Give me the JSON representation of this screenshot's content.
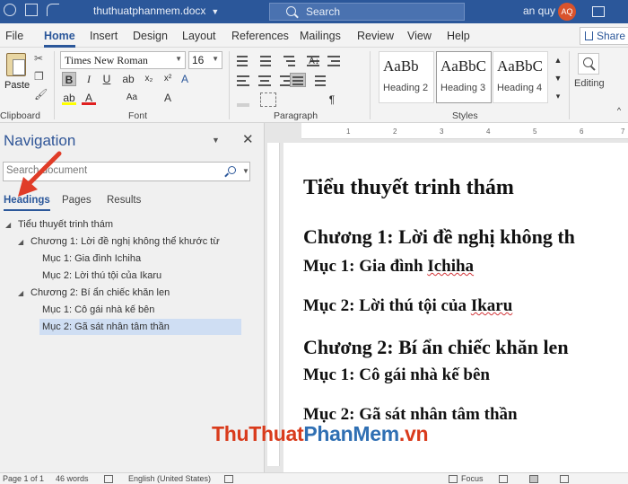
{
  "titlebar": {
    "doc_title": "thuthuatphanmem.docx",
    "search_placeholder": "Search",
    "user_name": "an quy",
    "user_initials": "AQ"
  },
  "tabs": [
    "File",
    "Home",
    "Insert",
    "Design",
    "Layout",
    "References",
    "Mailings",
    "Review",
    "View",
    "Help"
  ],
  "active_tab": "Home",
  "share_label": "Share",
  "ribbon": {
    "clipboard": {
      "paste_label": "Paste",
      "group_label": "Clipboard"
    },
    "font": {
      "font_name": "Times New Roman",
      "font_size": "16",
      "group_label": "Font"
    },
    "paragraph": {
      "group_label": "Paragraph"
    },
    "styles": {
      "group_label": "Styles",
      "items": [
        {
          "sample": "AaBb",
          "name": "Heading 2"
        },
        {
          "sample": "AaBbC",
          "name": "Heading 3"
        },
        {
          "sample": "AaBbC",
          "name": "Heading 4"
        }
      ]
    },
    "editing": {
      "label": "Editing"
    }
  },
  "nav": {
    "title": "Navigation",
    "search_placeholder": "Search document",
    "tabs": [
      "Headings",
      "Pages",
      "Results"
    ],
    "active_tab": "Headings",
    "tree": [
      {
        "label": "Tiểu thuyết trinh thám",
        "level": 1,
        "expanded": true
      },
      {
        "label": "Chương 1: Lời đề nghị không thể khước từ",
        "level": 2,
        "expanded": true
      },
      {
        "label": "Mục 1: Gia đình Ichiha",
        "level": 3
      },
      {
        "label": "Mục 2: Lời thú tội của Ikaru",
        "level": 3
      },
      {
        "label": "Chương 2: Bí ẩn chiếc khăn len",
        "level": 2,
        "expanded": true
      },
      {
        "label": "Mục 1: Cô gái nhà kế bên",
        "level": 3
      },
      {
        "label": "Mục 2: Gã sát nhân tâm thần",
        "level": 3,
        "selected": true
      }
    ]
  },
  "document": {
    "title": "Tiểu thuyết trinh thám",
    "ch1": "Chương 1: Lời đề nghị không th",
    "ch1_m1_prefix": "Mục 1: Gia đình ",
    "ch1_m1_word": "Ichiha",
    "ch1_m2_prefix": "Mục 2: Lời thú tội của ",
    "ch1_m2_word": "Ikaru",
    "ch2": "Chương 2: Bí ẩn chiếc khăn len",
    "ch2_m1": "Mục 1: Cô gái nhà kế bên",
    "ch2_m2": "Mục 2: Gã sát nhân tâm thần"
  },
  "ruler_marks": [
    "1",
    "2",
    "3",
    "4",
    "5",
    "6",
    "7"
  ],
  "watermark": {
    "part1": "ThuThuat",
    "part2": "PhanMem",
    "part3": ".vn"
  },
  "status": {
    "page": "Page 1 of 1",
    "words": "46 words",
    "language": "English (United States)",
    "focus": "Focus"
  },
  "colors": {
    "word_blue": "#2b579a",
    "annotation_red": "#e03c28"
  }
}
